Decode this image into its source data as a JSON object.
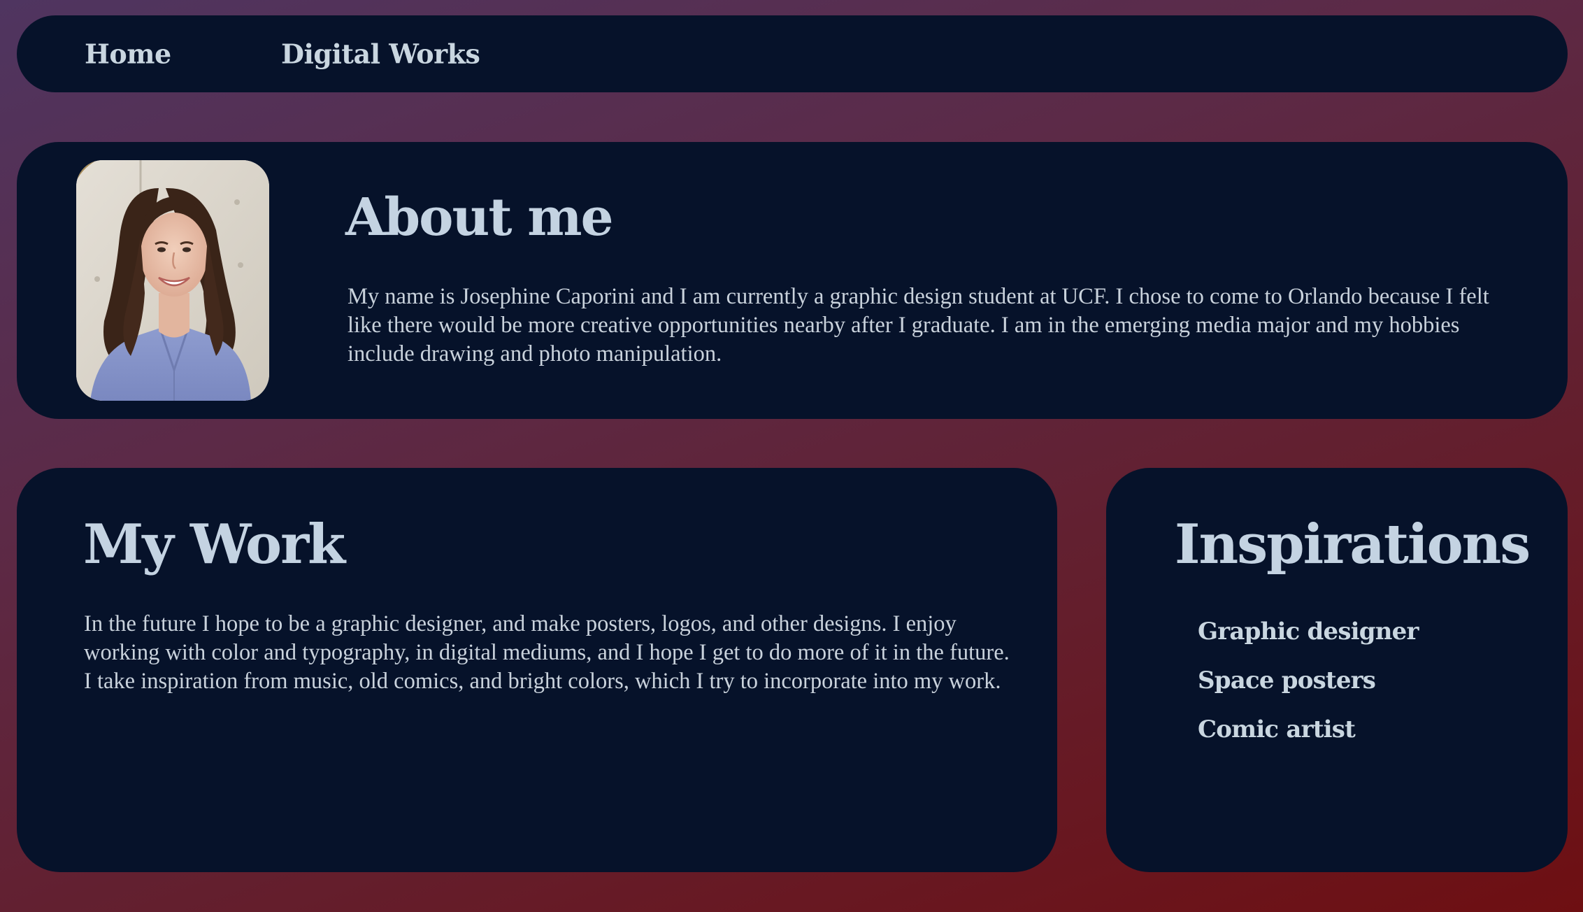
{
  "nav": {
    "items": [
      {
        "label": "Home"
      },
      {
        "label": "Digital Works"
      }
    ]
  },
  "about": {
    "title": "About me",
    "text": "My name is Josephine Caporini and I am currently a graphic design student at UCF. I chose to come to Orlando because I felt like there would be more creative opportunities nearby after I graduate. I am in the emerging media major and my hobbies include drawing and photo manipulation."
  },
  "work": {
    "title": "My Work",
    "text": "In the future I hope to be a graphic designer, and make posters, logos, and other designs. I enjoy working with color and typography, in digital mediums, and I hope I get to do more of it in the future. I take inspiration from music, old comics, and bright colors, which I try to incorporate into my work."
  },
  "inspirations": {
    "title": "Inspirations",
    "items": [
      "Graphic designer",
      "Space posters",
      "Comic artist"
    ]
  },
  "colors": {
    "panel": "#06122a",
    "heading": "#c4d3e2",
    "text": "#c9d2dc",
    "gradient_start": "#4f3560",
    "gradient_end": "#6e0f12"
  }
}
